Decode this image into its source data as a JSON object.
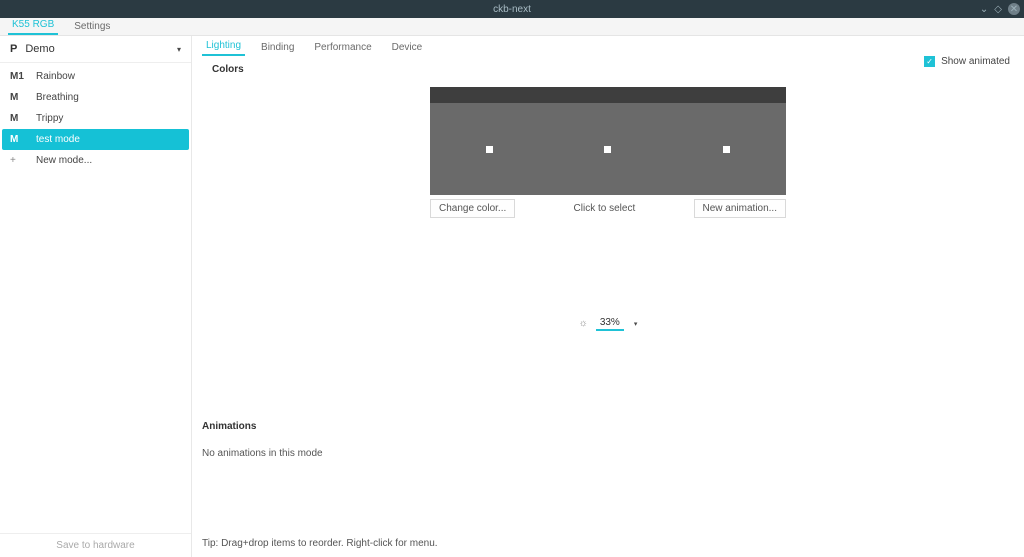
{
  "window": {
    "title": "ckb-next"
  },
  "menubar": {
    "tabs": [
      "K55 RGB",
      "Settings"
    ],
    "active": 0
  },
  "sidebar": {
    "device": {
      "tag": "P",
      "name": "Demo"
    },
    "modes": [
      {
        "tag": "M1",
        "label": "Rainbow"
      },
      {
        "tag": "M",
        "label": "Breathing"
      },
      {
        "tag": "M",
        "label": "Trippy"
      },
      {
        "tag": "M",
        "label": "test mode"
      }
    ],
    "new_mode": {
      "tag": "+",
      "label": "New mode..."
    },
    "selected": 3,
    "save": "Save to hardware"
  },
  "subtabs": {
    "items": [
      "Lighting",
      "Binding",
      "Performance",
      "Device"
    ],
    "active": 0
  },
  "colors": {
    "title": "Colors",
    "show_animated": "Show animated",
    "change_color": "Change color...",
    "click_to_select": "Click to select",
    "new_animation": "New animation..."
  },
  "brightness": {
    "value": "33%"
  },
  "animations": {
    "title": "Animations",
    "empty": "No animations in this mode"
  },
  "tip": "Tip: Drag+drop items to reorder. Right-click for menu."
}
